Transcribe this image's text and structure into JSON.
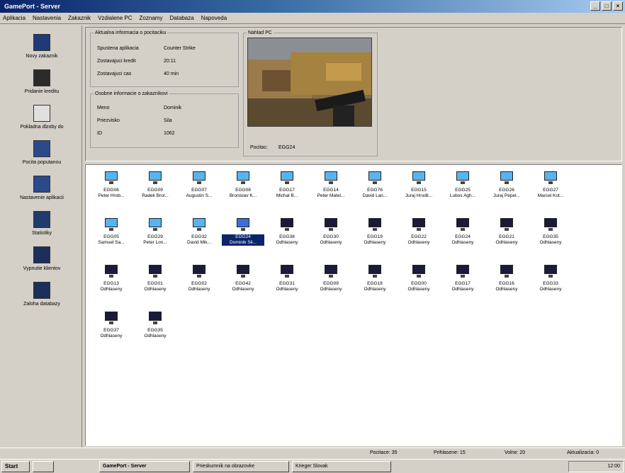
{
  "window": {
    "title": "GamePort - Server"
  },
  "menu": [
    "Aplikacia",
    "Nastavenia",
    "Zakaznik",
    "Vzdialene PC",
    "Zoznamy",
    "Databaza",
    "Napoveda"
  ],
  "sidebar": [
    {
      "label": "Novy zakaznik",
      "icon": "new-customer-icon",
      "color": "#1e3a78"
    },
    {
      "label": "Pridanie kreditu",
      "icon": "add-credit-icon",
      "color": "#2b2b2b"
    },
    {
      "label": "Pokladna dlzoby do",
      "icon": "clock-icon",
      "color": "#e0e0e0"
    },
    {
      "label": "Pocita poputanou",
      "icon": "pen-icon",
      "color": "#2a4a8a"
    },
    {
      "label": "Nastavenie aplikacii",
      "icon": "settings-icon",
      "color": "#2a4a8a"
    },
    {
      "label": "Statistiky",
      "icon": "stats-icon",
      "color": "#223a6e"
    },
    {
      "label": "Vypnutie klientov",
      "icon": "shutdown-icon",
      "color": "#1b2f5a"
    },
    {
      "label": "Zaloha databazy",
      "icon": "backup-icon",
      "color": "#1b2f5a"
    }
  ],
  "info": {
    "legend": "Aktualna informacia o pocitaciku",
    "rows": [
      {
        "label": "Spustena aplikacia",
        "value": "Counter Strike"
      },
      {
        "label": "Zostavajuci kredit",
        "value": "20:11"
      },
      {
        "label": "Zostavajuci cas",
        "value": "40 min"
      }
    ]
  },
  "user": {
    "legend": "Osobne informacie o zakaznikovi",
    "rows": [
      {
        "label": "Meno",
        "value": "Dominik"
      },
      {
        "label": "Priezvisko",
        "value": "Sila"
      },
      {
        "label": "ID",
        "value": "1062"
      }
    ]
  },
  "preview": {
    "legend": "Nahlad PC",
    "pocitac_label": "Pocitac:",
    "pocitac_value": "EGG24"
  },
  "computers": [
    {
      "id": "EGG06",
      "user": "Peter Hrob...",
      "state": "online"
    },
    {
      "id": "EGG09",
      "user": "Radek Brol...",
      "state": "online"
    },
    {
      "id": "EGG07",
      "user": "Augustin S...",
      "state": "online"
    },
    {
      "id": "EGG08",
      "user": "Bronislav K...",
      "state": "online"
    },
    {
      "id": "EGG17",
      "user": "Michal B...",
      "state": "online"
    },
    {
      "id": "EGG14",
      "user": "Peter Matel...",
      "state": "online"
    },
    {
      "id": "EGG76",
      "user": "David Lan...",
      "state": "online"
    },
    {
      "id": "EGG15",
      "user": "Juraj Hrudli...",
      "state": "online"
    },
    {
      "id": "EGG25",
      "user": "Lubos Agh...",
      "state": "online"
    },
    {
      "id": "EGG26",
      "user": "Juraj Pepel...",
      "state": "online"
    },
    {
      "id": "EGG27",
      "user": "Marcel Kot...",
      "state": "online"
    },
    {
      "id": "EGG05",
      "user": "Samuel Sa...",
      "state": "online"
    },
    {
      "id": "EGG29",
      "user": "Peter Lon...",
      "state": "online"
    },
    {
      "id": "EGG32",
      "user": "David Mik...",
      "state": "online"
    },
    {
      "id": "EGG24",
      "user": "Dominik Sil...",
      "state": "selected"
    },
    {
      "id": "EGG38",
      "user": "Odhlaseny",
      "state": "offline"
    },
    {
      "id": "EGG30",
      "user": "Odhlaseny",
      "state": "offline"
    },
    {
      "id": "EGG19",
      "user": "Odhlaseny",
      "state": "offline"
    },
    {
      "id": "EGG22",
      "user": "Odhlaseny",
      "state": "offline"
    },
    {
      "id": "EGG24",
      "user": "Odhlaseny",
      "state": "offline"
    },
    {
      "id": "EGG21",
      "user": "Odhlaseny",
      "state": "offline"
    },
    {
      "id": "EGG35",
      "user": "Odhlaseny",
      "state": "offline"
    },
    {
      "id": "EGG13",
      "user": "Odhlaseny",
      "state": "offline"
    },
    {
      "id": "EGG01",
      "user": "Odhlaseny",
      "state": "offline"
    },
    {
      "id": "EGG02",
      "user": "Odhlaseny",
      "state": "offline"
    },
    {
      "id": "EGG42",
      "user": "Odhlaseny",
      "state": "offline"
    },
    {
      "id": "EGG31",
      "user": "Odhlaseny",
      "state": "offline"
    },
    {
      "id": "EGG09",
      "user": "Odhlaseny",
      "state": "offline"
    },
    {
      "id": "EGG18",
      "user": "Odhlaseny",
      "state": "offline"
    },
    {
      "id": "EGG00",
      "user": "Odhlaseny",
      "state": "offline"
    },
    {
      "id": "EGG17",
      "user": "Odhlaseny",
      "state": "offline"
    },
    {
      "id": "EGG16",
      "user": "Odhlaseny",
      "state": "offline"
    },
    {
      "id": "EGG33",
      "user": "Odhlaseny",
      "state": "offline"
    },
    {
      "id": "EGG37",
      "user": "Odhlaseny",
      "state": "offline"
    },
    {
      "id": "EGG35",
      "user": "Odhlaseny",
      "state": "offline"
    }
  ],
  "status": {
    "pocitace": "Pocitace: 35",
    "prihlasene": "Prihlasene: 15",
    "volne": "Volne: 20",
    "aktualizacia": "Aktualizacia: 0"
  },
  "taskbar": {
    "start": "Start",
    "items": [
      "GamePort - Server",
      "Prieskumnik na obrazovke",
      "Krieger Slovak"
    ],
    "clock": "12:00"
  }
}
